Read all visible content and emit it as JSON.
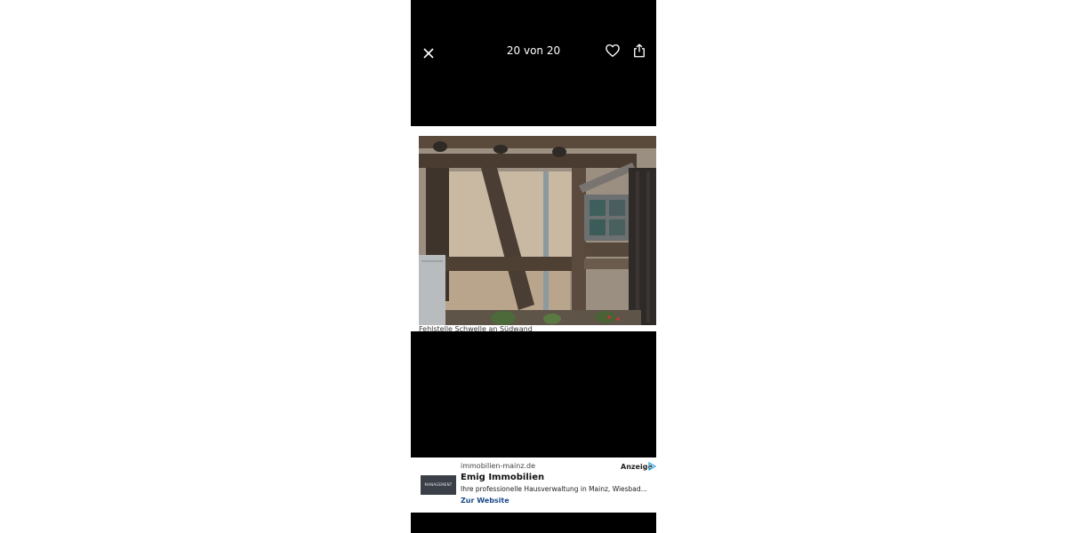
{
  "header": {
    "counter": "20 von 20",
    "close_icon": "close-icon",
    "favorite_icon": "heart-icon",
    "share_icon": "share-icon"
  },
  "photo": {
    "caption": "Fehlstelle Schwelle an Südwand"
  },
  "ad": {
    "domain": "immobilien-mainz.de",
    "label": "Anzeige",
    "thumb_text": "MANAGEMENT",
    "title": "Emig Immobilien",
    "description": "Ihre professionelle Hausverwaltung in Mainz, Wiesbad...",
    "cta": "Zur Website"
  },
  "colors": {
    "background": "#000000",
    "text": "#ffffff",
    "ad_cta": "#1a4a8a"
  }
}
